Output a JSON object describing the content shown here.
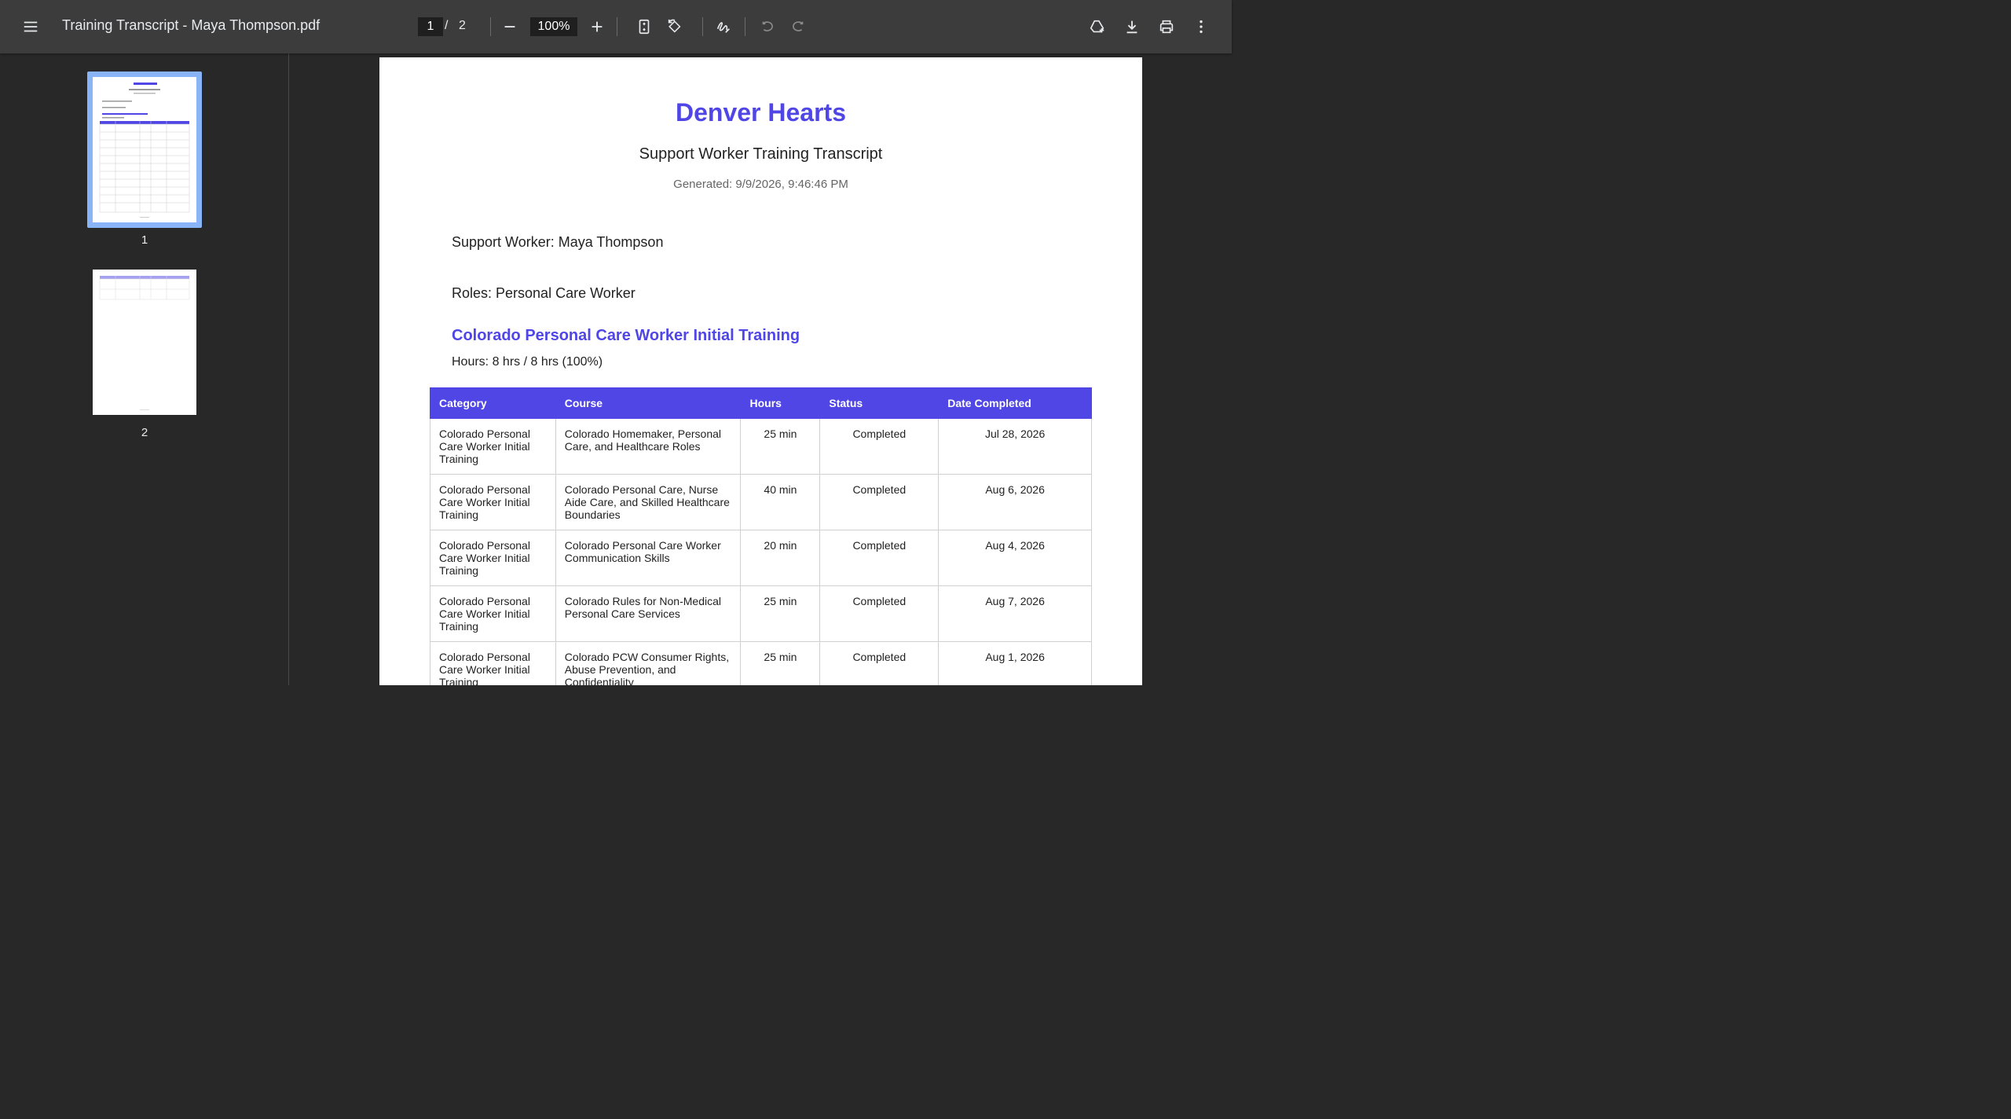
{
  "toolbar": {
    "filename": "Training Transcript - Maya Thompson.pdf",
    "current_page": "1",
    "separator": "/",
    "total_pages": "2",
    "zoom": "100%"
  },
  "sidebar": {
    "thumbnails": [
      {
        "label": "1"
      },
      {
        "label": "2"
      }
    ]
  },
  "document": {
    "org_name": "Denver Hearts",
    "subtitle": "Support Worker Training Transcript",
    "generated": "Generated: 9/9/2026, 9:46:46 PM",
    "support_worker": "Support Worker: Maya Thompson",
    "roles": "Roles: Personal Care Worker",
    "section_title": "Colorado Personal Care Worker Initial Training",
    "hours": "Hours: 8 hrs / 8 hrs (100%)",
    "table": {
      "headers": [
        "Category",
        "Course",
        "Hours",
        "Status",
        "Date Completed"
      ],
      "rows": [
        [
          "Colorado Personal Care Worker Initial Training",
          "Colorado Homemaker, Personal Care, and Healthcare Roles",
          "25 min",
          "Completed",
          "Jul 28, 2026"
        ],
        [
          "Colorado Personal Care Worker Initial Training",
          "Colorado Personal Care, Nurse Aide Care, and Skilled Healthcare Boundaries",
          "40 min",
          "Completed",
          "Aug 6, 2026"
        ],
        [
          "Colorado Personal Care Worker Initial Training",
          "Colorado Personal Care Worker Communication Skills",
          "20 min",
          "Completed",
          "Aug 4, 2026"
        ],
        [
          "Colorado Personal Care Worker Initial Training",
          "Colorado Rules for Non-Medical Personal Care Services",
          "25 min",
          "Completed",
          "Aug 7, 2026"
        ],
        [
          "Colorado Personal Care Worker Initial Training",
          "Colorado PCW Consumer Rights, Abuse Prevention, and Confidentiality",
          "25 min",
          "Completed",
          "Aug 1, 2026"
        ]
      ]
    }
  },
  "colors": {
    "accent": "#4f46e5",
    "toolbar_bg": "#3c3c3c",
    "viewer_bg": "#282828",
    "thumb_selected": "#8ab4f8"
  }
}
